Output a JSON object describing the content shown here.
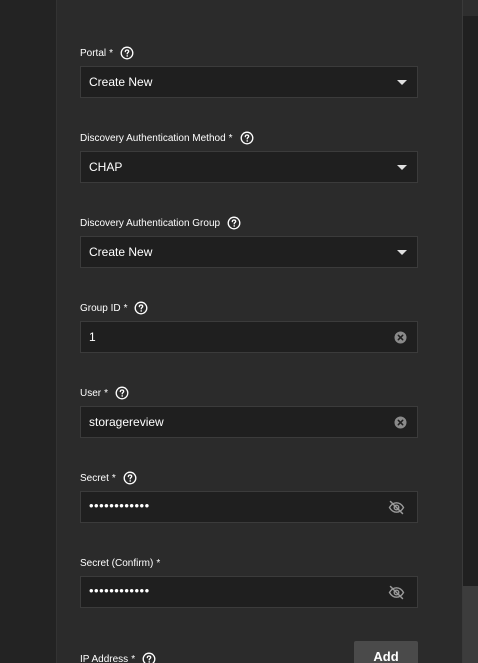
{
  "form": {
    "portal": {
      "label": "Portal",
      "required": "*",
      "value": "Create New"
    },
    "discovery_auth_method": {
      "label": "Discovery Authentication Method",
      "required": "*",
      "value": "CHAP"
    },
    "discovery_auth_group": {
      "label": "Discovery Authentication Group",
      "value": "Create New"
    },
    "group_id": {
      "label": "Group ID",
      "required": "*",
      "value": "1"
    },
    "user": {
      "label": "User",
      "required": "*",
      "value": "storagereview"
    },
    "secret": {
      "label": "Secret",
      "required": "*",
      "value": "••••••••••••"
    },
    "secret_confirm": {
      "label": "Secret (Confirm)",
      "required": "*",
      "value": "••••••••••••"
    },
    "ip_address": {
      "label": "IP Address",
      "required": "*",
      "add_label": "Add"
    }
  },
  "icons": {
    "help": "help-circle-icon",
    "dropdown": "caret-down-icon",
    "clear": "clear-circle-icon",
    "visibility": "eye-off-icon"
  },
  "colors": {
    "background": "#282828",
    "input_background": "#1f1f1f",
    "input_border": "#3b3b3b",
    "text": "#ffffff",
    "button": "#4a4a4a"
  }
}
